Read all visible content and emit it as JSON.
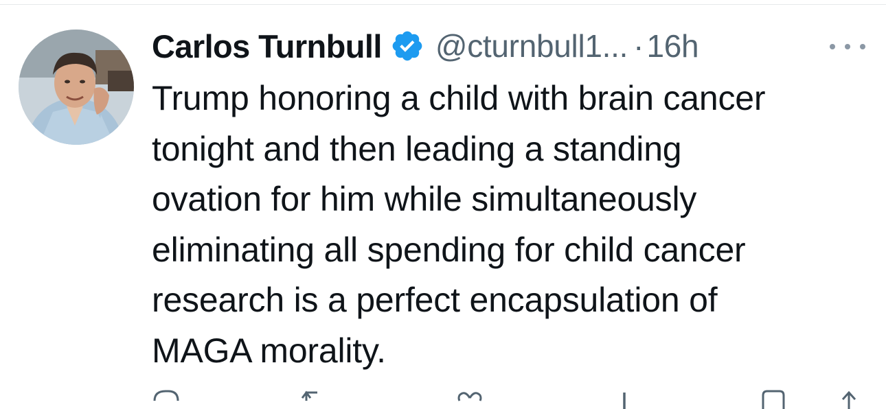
{
  "tweet": {
    "author": {
      "display_name": "Carlos Turnbull",
      "handle": "@cturnbull1...",
      "verified": true,
      "avatar": "profile-photo"
    },
    "separator": "·",
    "timestamp": "16h",
    "more_icon": "more-horizontal-icon",
    "text_lines": [
      "Trump honoring a child with brain cancer",
      "tonight and then leading a standing",
      "ovation for him while simultaneously",
      "eliminating all spending for child cancer",
      "research is a perfect encapsulation of",
      "MAGA morality."
    ],
    "actions": [
      {
        "icon": "reply-icon"
      },
      {
        "icon": "retweet-icon"
      },
      {
        "icon": "like-icon"
      },
      {
        "icon": "views-icon"
      },
      {
        "icon": "bookmark-icon"
      },
      {
        "icon": "share-icon"
      }
    ]
  },
  "colors": {
    "text": "#0f1419",
    "secondary": "#536471",
    "verified_badge": "#1d9bf0",
    "divider": "#e6e9ea"
  }
}
